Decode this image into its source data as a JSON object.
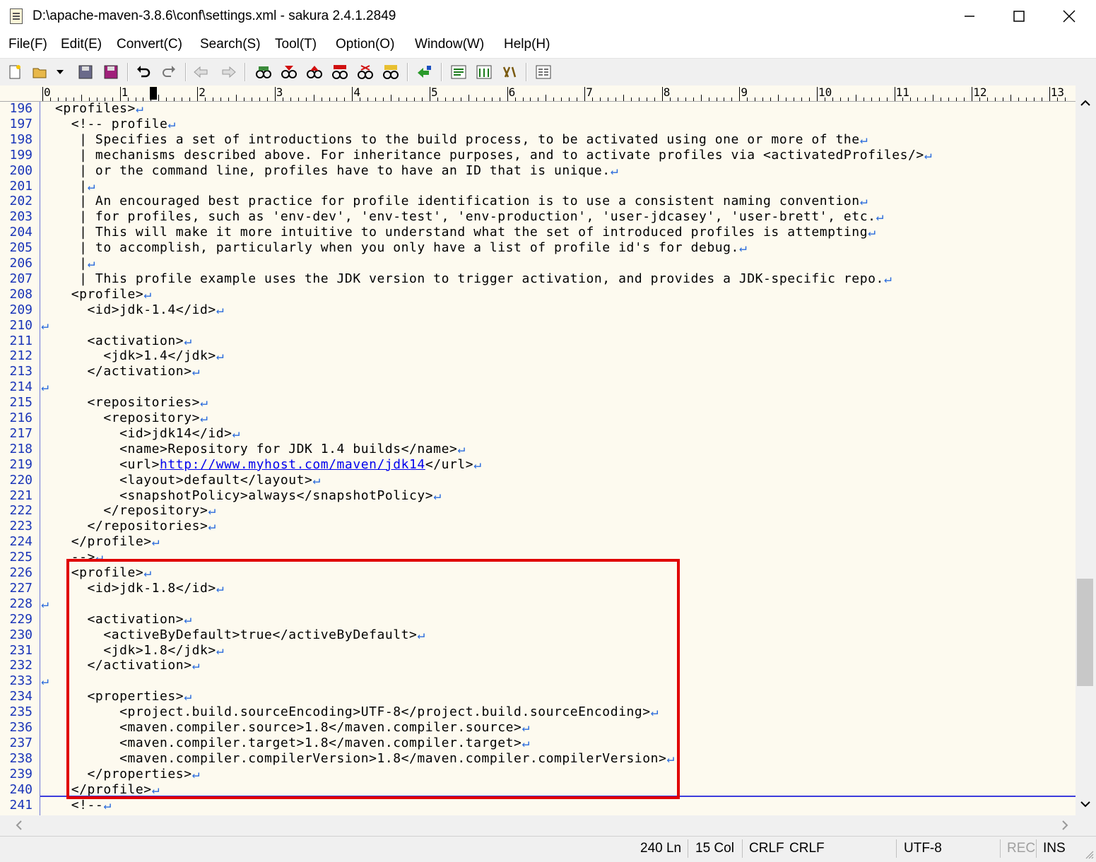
{
  "window": {
    "title": "D:\\apache-maven-3.8.6\\conf\\settings.xml - sakura 2.4.1.2849"
  },
  "menu": [
    "File(F)",
    "Edit(E)",
    "Convert(C)",
    "Search(S)",
    "Tool(T)",
    "Option(O)",
    "Window(W)",
    "Help(H)"
  ],
  "ruler": [
    "0",
    "1",
    "2",
    "3",
    "4",
    "5",
    "6",
    "7",
    "8",
    "9",
    "10",
    "11",
    "12",
    "13"
  ],
  "lines": [
    {
      "n": "196",
      "t": "<profiles>"
    },
    {
      "n": "197",
      "t": "  <!-- profile"
    },
    {
      "n": "198",
      "t": "   | Specifies a set of introductions to the build process, to be activated using one or more of the"
    },
    {
      "n": "199",
      "t": "   | mechanisms described above. For inheritance purposes, and to activate profiles via <activatedProfiles/>"
    },
    {
      "n": "200",
      "t": "   | or the command line, profiles have to have an ID that is unique."
    },
    {
      "n": "201",
      "t": "   |"
    },
    {
      "n": "202",
      "t": "   | An encouraged best practice for profile identification is to use a consistent naming convention"
    },
    {
      "n": "203",
      "t": "   | for profiles, such as 'env-dev', 'env-test', 'env-production', 'user-jdcasey', 'user-brett', etc."
    },
    {
      "n": "204",
      "t": "   | This will make it more intuitive to understand what the set of introduced profiles is attempting"
    },
    {
      "n": "205",
      "t": "   | to accomplish, particularly when you only have a list of profile id's for debug."
    },
    {
      "n": "206",
      "t": "   |"
    },
    {
      "n": "207",
      "t": "   | This profile example uses the JDK version to trigger activation, and provides a JDK-specific repo."
    },
    {
      "n": "208",
      "t": "  <profile>"
    },
    {
      "n": "209",
      "t": "    <id>jdk-1.4</id>"
    },
    {
      "n": "210",
      "t": ""
    },
    {
      "n": "211",
      "t": "    <activation>"
    },
    {
      "n": "212",
      "t": "      <jdk>1.4</jdk>"
    },
    {
      "n": "213",
      "t": "    </activation>"
    },
    {
      "n": "214",
      "t": ""
    },
    {
      "n": "215",
      "t": "    <repositories>"
    },
    {
      "n": "216",
      "t": "      <repository>"
    },
    {
      "n": "217",
      "t": "        <id>jdk14</id>"
    },
    {
      "n": "218",
      "t": "        <name>Repository for JDK 1.4 builds</name>"
    },
    {
      "n": "219",
      "t": "        <url>",
      "url": "http://www.myhost.com/maven/jdk14",
      "after": "</url>"
    },
    {
      "n": "220",
      "t": "        <layout>default</layout>"
    },
    {
      "n": "221",
      "t": "        <snapshotPolicy>always</snapshotPolicy>"
    },
    {
      "n": "222",
      "t": "      </repository>"
    },
    {
      "n": "223",
      "t": "    </repositories>"
    },
    {
      "n": "224",
      "t": "  </profile>"
    },
    {
      "n": "225",
      "t": "  -->"
    },
    {
      "n": "226",
      "t": "  <profile>"
    },
    {
      "n": "227",
      "t": "    <id>jdk-1.8</id>"
    },
    {
      "n": "228",
      "t": ""
    },
    {
      "n": "229",
      "t": "    <activation>"
    },
    {
      "n": "230",
      "t": "      <activeByDefault>true</activeByDefault>"
    },
    {
      "n": "231",
      "t": "      <jdk>1.8</jdk>"
    },
    {
      "n": "232",
      "t": "    </activation>"
    },
    {
      "n": "233",
      "t": ""
    },
    {
      "n": "234",
      "t": "    <properties>"
    },
    {
      "n": "235",
      "t": "        <project.build.sourceEncoding>UTF-8</project.build.sourceEncoding>"
    },
    {
      "n": "236",
      "t": "        <maven.compiler.source>1.8</maven.compiler.source>"
    },
    {
      "n": "237",
      "t": "        <maven.compiler.target>1.8</maven.compiler.target>"
    },
    {
      "n": "238",
      "t": "        <maven.compiler.compilerVersion>1.8</maven.compiler.compilerVersion>"
    },
    {
      "n": "239",
      "t": "    </properties>"
    },
    {
      "n": "240",
      "t": "  </profile>"
    },
    {
      "n": "241",
      "t": "  <!--"
    }
  ],
  "status": {
    "line": "240 Ln",
    "col": "15 Col",
    "eol1": "CRLF",
    "eol2": "CRLF",
    "encoding": "UTF-8",
    "rec": "REC",
    "ins": "INS"
  },
  "colors": {
    "background": "#fdfaef",
    "line_numbers": "#1a35b8",
    "eol_mark": "#2a6bdc",
    "highlight_box": "#e00000",
    "link": "#0000ee"
  },
  "eol_symbol": "↵"
}
